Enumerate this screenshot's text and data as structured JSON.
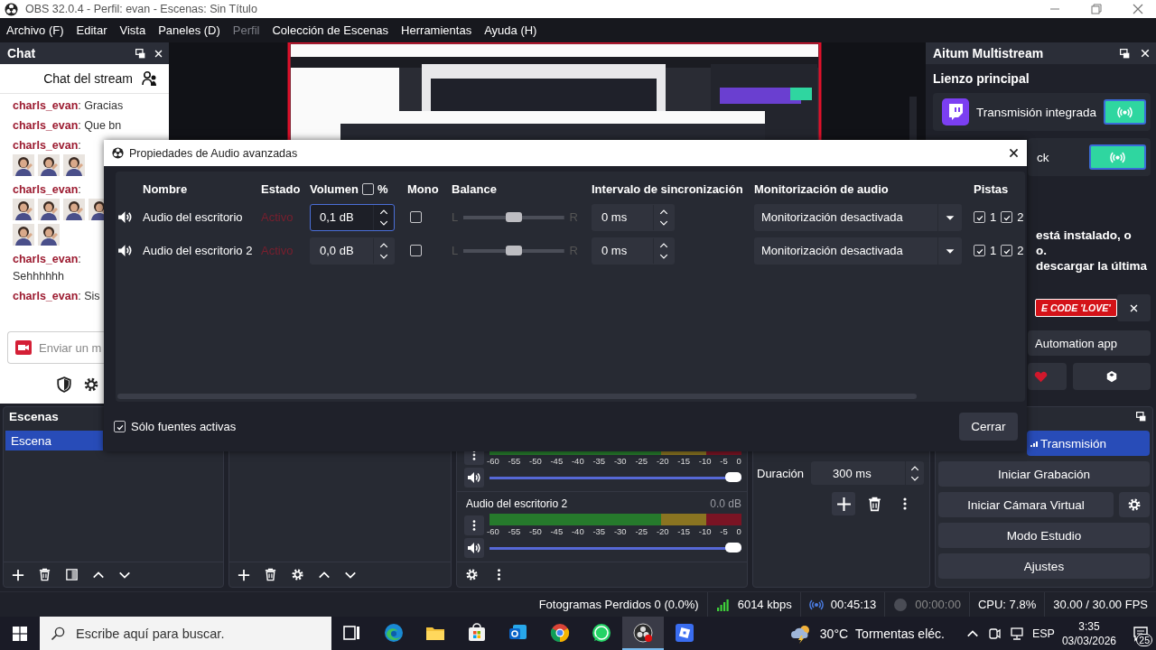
{
  "window": {
    "title": "OBS 32.0.4 - Perfil: evan - Escenas: Sin Título"
  },
  "menu": [
    {
      "label": "Archivo (F)",
      "disabled": false
    },
    {
      "label": "Editar",
      "disabled": false
    },
    {
      "label": "Vista",
      "disabled": false
    },
    {
      "label": "Paneles (D)",
      "disabled": false
    },
    {
      "label": "Perfil",
      "disabled": true
    },
    {
      "label": "Colección de Escenas",
      "disabled": false
    },
    {
      "label": "Herramientas",
      "disabled": false
    },
    {
      "label": "Ayuda (H)",
      "disabled": false
    }
  ],
  "chat_dock": {
    "title": "Chat",
    "heading": "Chat del stream",
    "messages": [
      {
        "kind": "inline",
        "text": "**charls_evan**: Gracias"
      },
      {
        "kind": "inline",
        "text": "**charls_evan**: Que bn"
      },
      {
        "kind": "emotes",
        "text": "**charls_evan**:"
      },
      {
        "kind": "emotes",
        "text": "**charls_evan**:"
      },
      {
        "kind": "block",
        "text": "**charls_evan**:",
        "body": "Sehhhhhh"
      },
      {
        "kind": "inline",
        "text": "**charls_evan**: Sis"
      }
    ],
    "input": {
      "placeholder": "Enviar un m"
    }
  },
  "aitum_dock": {
    "title": "Aitum Multistream",
    "canvas_title": "Lienzo principal",
    "outputs": [
      {
        "name": "Transmisión integrada"
      },
      {
        "name": "ck"
      }
    ],
    "notice_lines": [
      "está instalado, o",
      "o.",
      "descargar la última"
    ],
    "promo": "E CODE *'LOVE'*",
    "automation_button": "Automation app"
  },
  "scenes_dock": {
    "title": "Escenas",
    "scenes": [
      {
        "name": "Escena",
        "selected": true
      }
    ]
  },
  "mixer": {
    "channels": [
      {
        "level": 1,
        "scale": [
          "-60",
          "-55",
          "-50",
          "-45",
          "-40",
          "-35",
          "-30",
          "-25",
          "-20",
          "-15",
          "-10",
          "-5",
          "0"
        ]
      },
      {
        "name": "Audio del escritorio 2",
        "reading": "0.0 dB",
        "level": 1,
        "scale": [
          "-60",
          "-55",
          "-50",
          "-45",
          "-40",
          "-35",
          "-30",
          "-25",
          "-20",
          "-15",
          "-10",
          "-5",
          "0"
        ]
      }
    ]
  },
  "transition": {
    "duration_label": "Duración",
    "duration": "300 ms"
  },
  "controls": {
    "buttons": [
      {
        "label": "Transmisión",
        "kind": "plain",
        "active": true
      },
      {
        "label": "Iniciar Grabación",
        "kind": "plain",
        "active": false
      },
      {
        "label": "Iniciar Cámara Virtual",
        "kind": "with_settings",
        "active": false
      },
      {
        "label": "Modo Estudio",
        "kind": "plain",
        "active": false
      },
      {
        "label": "Ajustes",
        "kind": "plain",
        "active": false
      }
    ]
  },
  "status_bar": {
    "dropped_frames": "Fotogramas Perdidos 0 (0.0%)",
    "bitrate": "6014 kbps",
    "stream_time": "00:45:13",
    "record_time": "00:00:00",
    "cpu": "CPU: 7.8%",
    "fps": "30.00 / 30.00 FPS"
  },
  "taskbar": {
    "search_placeholder": "Escribe aquí para buscar.",
    "apps": [
      {
        "kind": "task-view",
        "selected": false
      },
      {
        "kind": "edge",
        "selected": false
      },
      {
        "kind": "folder",
        "selected": false
      },
      {
        "kind": "store",
        "selected": false
      },
      {
        "kind": "mail",
        "selected": false
      },
      {
        "kind": "chrome",
        "selected": false
      },
      {
        "kind": "whatsapp",
        "selected": false
      },
      {
        "kind": "obs",
        "selected": true
      },
      {
        "kind": "roblox",
        "selected": false
      }
    ],
    "temperature": "30°C",
    "weather": "Tormentas eléc.",
    "language": "ESP",
    "time": "3:35",
    "date": "03/03/2026",
    "notifications": "25"
  },
  "dialog": {
    "title": "Propiedades de Audio avanzadas",
    "columns": [
      "Nombre",
      "Estado",
      "Volumen",
      "Mono",
      "Balance",
      "Intervalo de sincronización",
      "Monitorización de audio",
      "Pistas"
    ],
    "percent": {
      "label": "%",
      "checked": false
    },
    "rows": [
      {
        "name": "Audio del escritorio",
        "status": "Activo",
        "volume": "0,1 dB",
        "focused": true,
        "mono": false,
        "left": "L",
        "right": "R",
        "level": 0.5,
        "sync": "0 ms",
        "monitoring": "Monitorización desactivada",
        "tracks": [
          {
            "label": "1",
            "checked": true
          },
          {
            "label": "2",
            "checked": true
          }
        ]
      },
      {
        "name": "Audio del escritorio 2",
        "status": "Activo",
        "volume": "0,0 dB",
        "focused": false,
        "mono": false,
        "left": "L",
        "right": "R",
        "level": 0.5,
        "sync": "0 ms",
        "monitoring": "Monitorización desactivada",
        "tracks": [
          {
            "label": "1",
            "checked": true
          },
          {
            "label": "2",
            "checked": true
          }
        ]
      }
    ],
    "active_only": {
      "label": "Sólo fuentes activas",
      "checked": true
    },
    "close_button": "Cerrar"
  }
}
